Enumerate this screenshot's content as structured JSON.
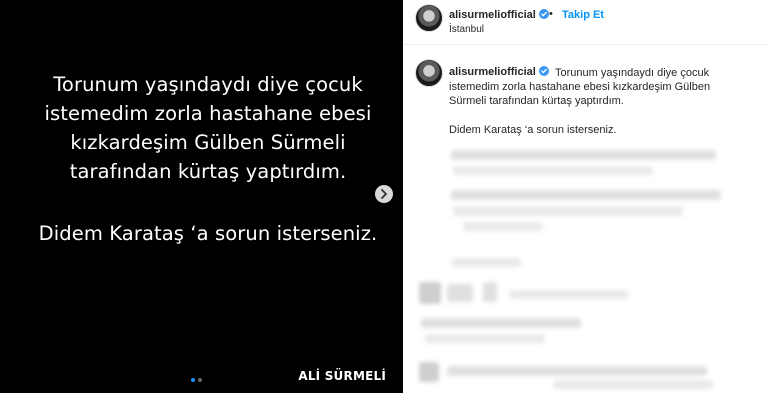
{
  "post": {
    "media": {
      "line_1": "Torunum yaşındaydı diye çocuk",
      "line_2": "istemedim zorla hastahane ebesi",
      "line_3": "kızkardeşim Gülben Sürmeli",
      "line_4": "tarafından kürtaş yaptırdım.",
      "line_5": "Didem Karataş ‘a sorun isterseniz.",
      "watermark": "ALİ SÜRMELİ",
      "carousel_count": 2,
      "carousel_active_index": 1,
      "next_icon": "chevron-right-icon"
    },
    "header": {
      "username": "alisurmeliofficial",
      "separator": "•",
      "follow_label": "Takip Et",
      "location": "İstanbul"
    },
    "caption": {
      "username": "alisurmeliofficial",
      "text": "Torunum yaşındaydı diye çocuk istemedim zorla hastahane ebesi kızkardeşim Gülben Sürmeli tarafından kürtaş yaptırdım.",
      "text_2": "Didem Karataş ‘a sorun isterseniz."
    }
  },
  "colors": {
    "follow": "#0095f6",
    "verified": "#3897f0",
    "media_background": "#000000",
    "text": "#262626"
  }
}
